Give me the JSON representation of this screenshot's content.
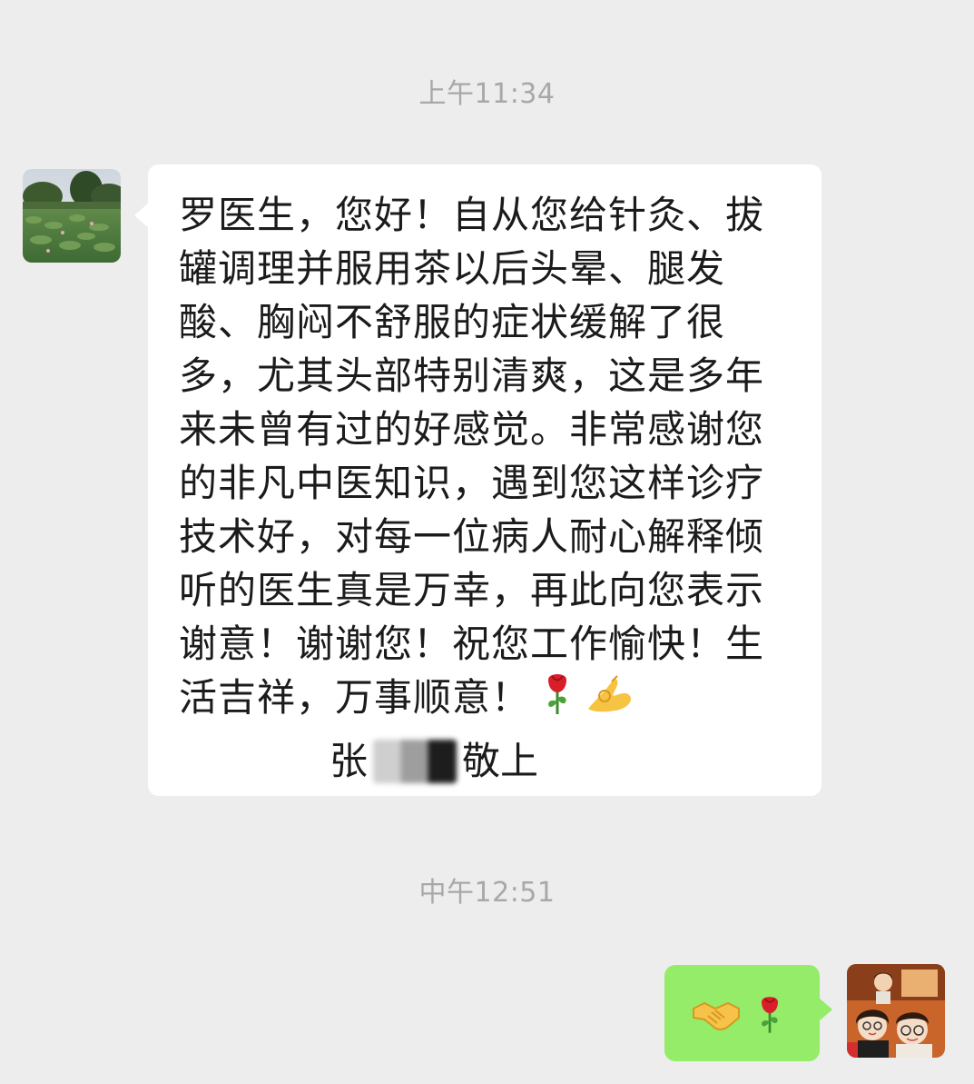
{
  "chat": {
    "time_1": "上午11:34",
    "time_2": "中午12:51",
    "incoming": {
      "avatar_icon": "lotus-pond-photo-avatar",
      "text": "罗医生，您好！自从您给针灸、拔罐调理并服用茶以后头晕、腿发酸、胸闷不舒服的症状缓解了很多，尤其头部特别清爽，这是多年来未曾有过的好感觉。非常感谢您的非凡中医知识，遇到您这样诊疗技术好，对每一位病人耐心解释倾听的医生真是万幸，再此向您表示谢意！谢谢您！祝您工作愉快！生活吉祥，万事顺意！",
      "trailing_emojis": [
        "rose-emoji",
        "ok-hand-emoji"
      ],
      "signature_surname": "张",
      "signature_suffix": "敬上"
    },
    "outgoing": {
      "avatar_icon": "cartoon-couple-avatar",
      "emojis": [
        "handshake-emoji",
        "rose-emoji"
      ]
    }
  },
  "colors": {
    "background": "#ededed",
    "incoming_bubble": "#ffffff",
    "outgoing_bubble": "#95ec69",
    "timestamp_text": "#a8a8a8",
    "message_text": "#1b1b1b"
  }
}
